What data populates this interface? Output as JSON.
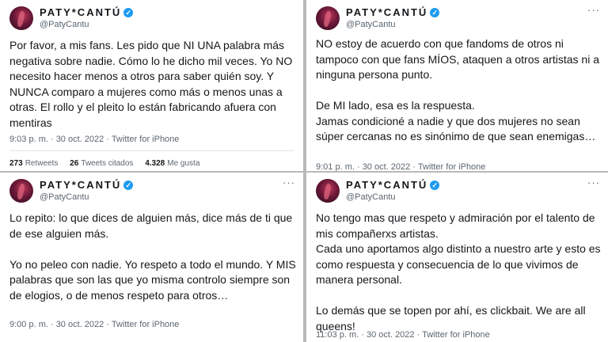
{
  "tweets": [
    {
      "display_name": "PATY*CANTÚ",
      "handle": "@PatyCantu",
      "text": "Por favor, a mis fans. Les pido que NI UNA palabra más negativa sobre nadie. Cómo lo he dicho mil veces. Yo NO necesito hacer menos a otros para saber quién soy. Y NUNCA comparo a mujeres como más o menos unas a otras. El rollo y el pleito lo están fabricando afuera con mentiras",
      "time": "9:03 p. m. · 30 oct. 2022 · Twitter for iPhone",
      "stats": {
        "retweets_count": "273",
        "retweets_label": "Retweets",
        "quotes_count": "26",
        "quotes_label": "Tweets citados",
        "likes_count": "4.328",
        "likes_label": "Me gusta"
      }
    },
    {
      "display_name": "PATY*CANTÚ",
      "handle": "@PatyCantu",
      "text": "NO estoy de acuerdo con que fandoms de otros ni tampoco con que fans MÍOS, ataquen a otros artistas ni a ninguna persona punto.\n\nDe MI lado, esa es la respuesta.\nJamas condicioné a nadie y que dos mujeres no sean súper cercanas no es sinónimo de que sean enemigas…",
      "time": "9:01 p. m. · 30 oct. 2022 · Twitter for iPhone"
    },
    {
      "display_name": "PATY*CANTÚ",
      "handle": "@PatyCantu",
      "text": "Lo repito: lo que dices de alguien más, dice más de ti que de ese alguien más.\n\nYo no peleo con nadie. Yo respeto a todo el mundo. Y MIS palabras que son las que yo misma controlo siempre son de elogios, o de menos respeto para otros…",
      "time": "9:00 p. m. · 30 oct. 2022 · Twitter for iPhone"
    },
    {
      "display_name": "PATY*CANTÚ",
      "handle": "@PatyCantu",
      "text": "No tengo mas que respeto y admiración por el talento de mis compañerxs artistas.\nCada uno aportamos algo distinto a nuestro arte y esto es como respuesta y consecuencia de lo que vivimos de manera personal.\n\nLo demás que se topen por ahí, es clickbait.  We are all queens!",
      "time": "11:03 p. m. · 30 oct. 2022 · Twitter for iPhone"
    }
  ],
  "icons": {
    "verified": "verified-badge-icon",
    "more": "more-options-icon",
    "avatar": "profile-avatar"
  },
  "colors": {
    "verified_blue": "#1d9bf0",
    "text": "#14171a",
    "secondary": "#5b6670"
  }
}
